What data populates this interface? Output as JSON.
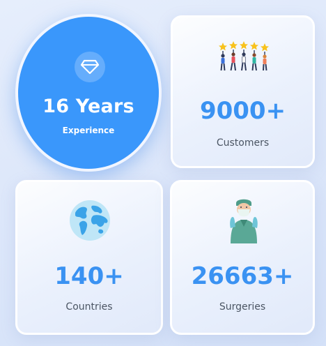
{
  "stats": {
    "experience": {
      "value": "16 Years",
      "label": "Experience",
      "icon": "diamond-icon"
    },
    "customers": {
      "value": "9000+",
      "label": "Customers",
      "icon": "people-holding-stars-icon"
    },
    "countries": {
      "value": "140+",
      "label": "Countries",
      "icon": "globe-icon"
    },
    "surgeries": {
      "value": "26663+",
      "label": "Surgeries",
      "icon": "surgeon-icon"
    }
  },
  "colors": {
    "accent": "#3a97fb",
    "number": "#3a92f2",
    "label": "#4b5563",
    "background": "#dde7fa"
  }
}
